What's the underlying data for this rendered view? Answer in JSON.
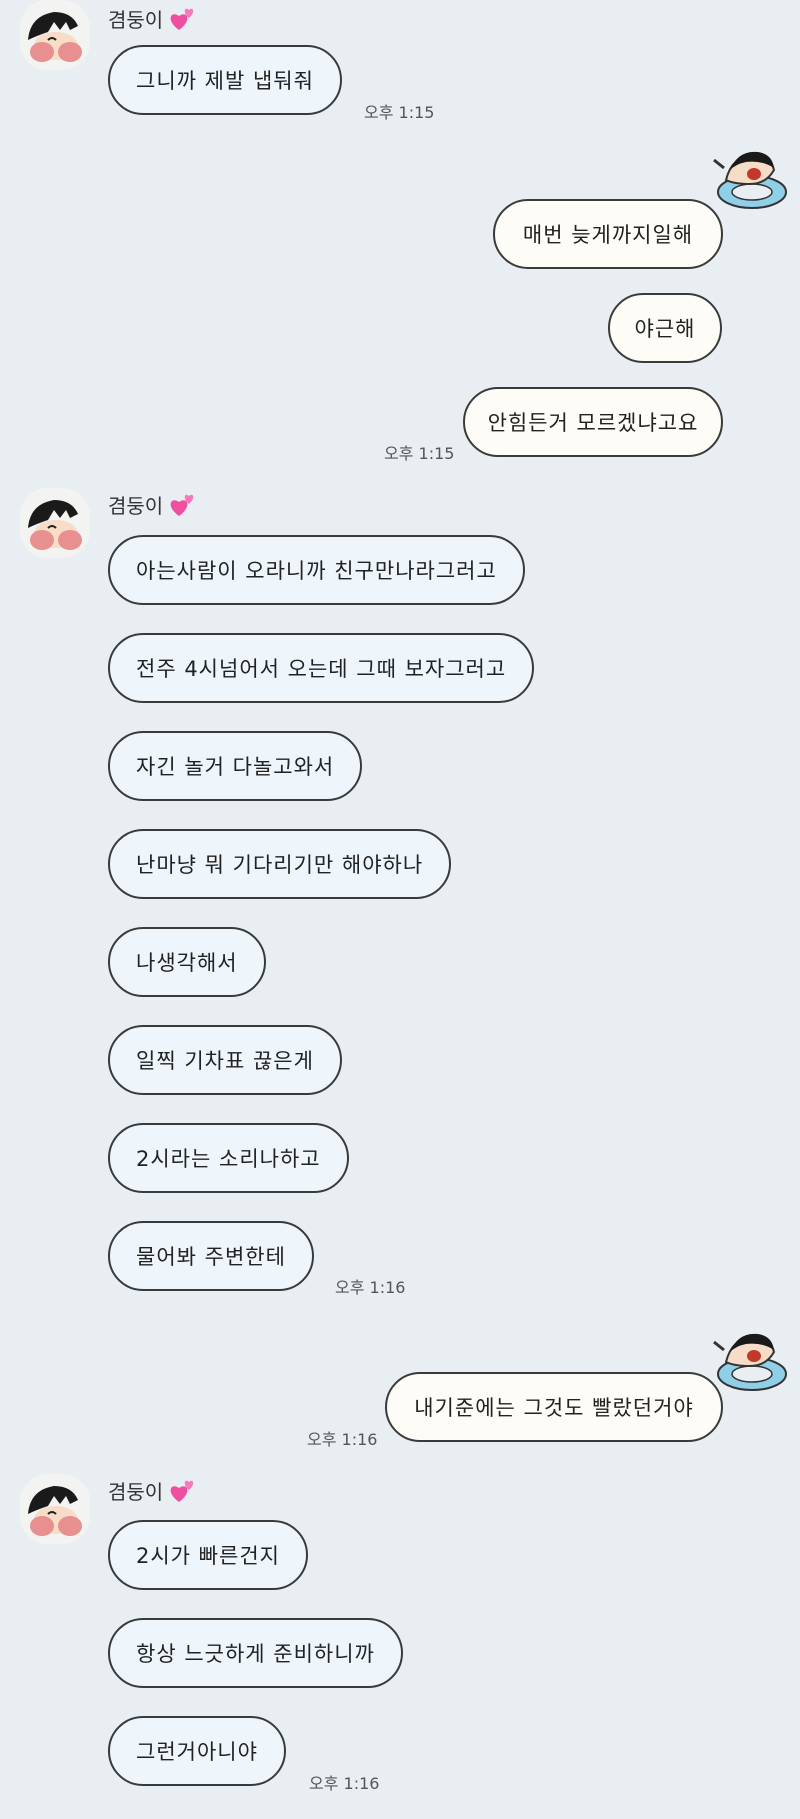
{
  "blocks": [
    {
      "sender": "겸둥이",
      "messages": [
        "그니까 제발 냅둬줘"
      ],
      "time": "오후 1:15"
    },
    {
      "messages": [
        "매번 늦게까지일해",
        "야근해",
        "안힘든거 모르겠냐고요"
      ],
      "time": "오후 1:15"
    },
    {
      "sender": "겸둥이",
      "messages": [
        "아는사람이 오라니까 친구만나라그러고",
        "전주 4시넘어서 오는데 그때 보자그러고",
        "자긴 놀거 다놀고와서",
        "난마냥 뭐 기다리기만 해야하나",
        "나생각해서",
        "일찍 기차표 끊은게",
        "2시라는 소리나하고",
        "물어봐 주변한테"
      ],
      "time": "오후 1:16"
    },
    {
      "messages": [
        "내기준에는 그것도 빨랐던거야"
      ],
      "time": "오후 1:16"
    },
    {
      "sender": "겸둥이",
      "messages": [
        "2시가 빠른건지",
        "항상 느긋하게 준비하니까",
        "그런거아니야"
      ],
      "time": "오후 1:16"
    }
  ],
  "icons": {
    "heart": "pink-hearts-icon",
    "avatar": "shinchan-avatar",
    "sticker": "shinchan-swim-ring-icon"
  }
}
